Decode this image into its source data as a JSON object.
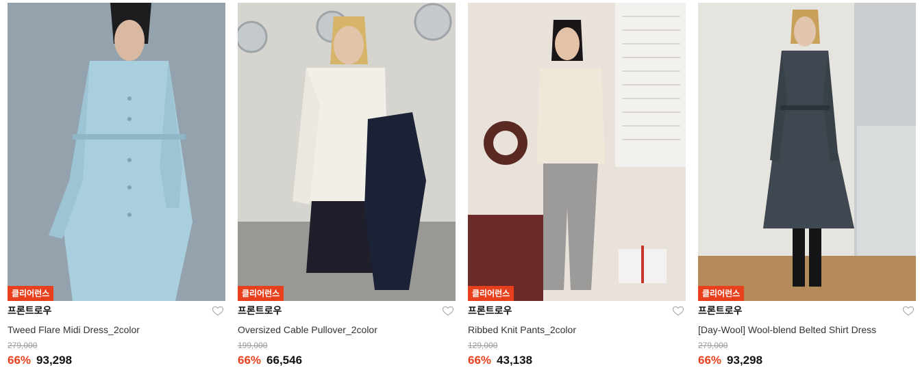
{
  "products": [
    {
      "badge": "클리어런스",
      "brand": "프론트로우",
      "name": "Tweed Flare Midi Dress_2color",
      "original_price": "279,000",
      "discount": "66%",
      "price": "93,298",
      "wishlist_icon": "heart-outline-icon",
      "photo": "model-light-blue-tweed-dress"
    },
    {
      "badge": "클리어런스",
      "brand": "프론트로우",
      "name": "Oversized Cable Pullover_2color",
      "original_price": "199,000",
      "discount": "66%",
      "price": "66,546",
      "wishlist_icon": "heart-outline-icon",
      "photo": "model-white-cable-knit"
    },
    {
      "badge": "클리어런스",
      "brand": "프론트로우",
      "name": "Ribbed Knit Pants_2color",
      "original_price": "129,000",
      "discount": "66%",
      "price": "43,138",
      "wishlist_icon": "heart-outline-icon",
      "photo": "model-grey-ribbed-pants"
    },
    {
      "badge": "클리어런스",
      "brand": "프론트로우",
      "name": "[Day-Wool] Wool-blend Belted Shirt Dress",
      "original_price": "279,000",
      "discount": "66%",
      "price": "93,298",
      "wishlist_icon": "heart-outline-icon",
      "photo": "model-charcoal-shirt-dress"
    }
  ],
  "colors": {
    "badge": "#e8401c",
    "discount": "#e8401c"
  }
}
